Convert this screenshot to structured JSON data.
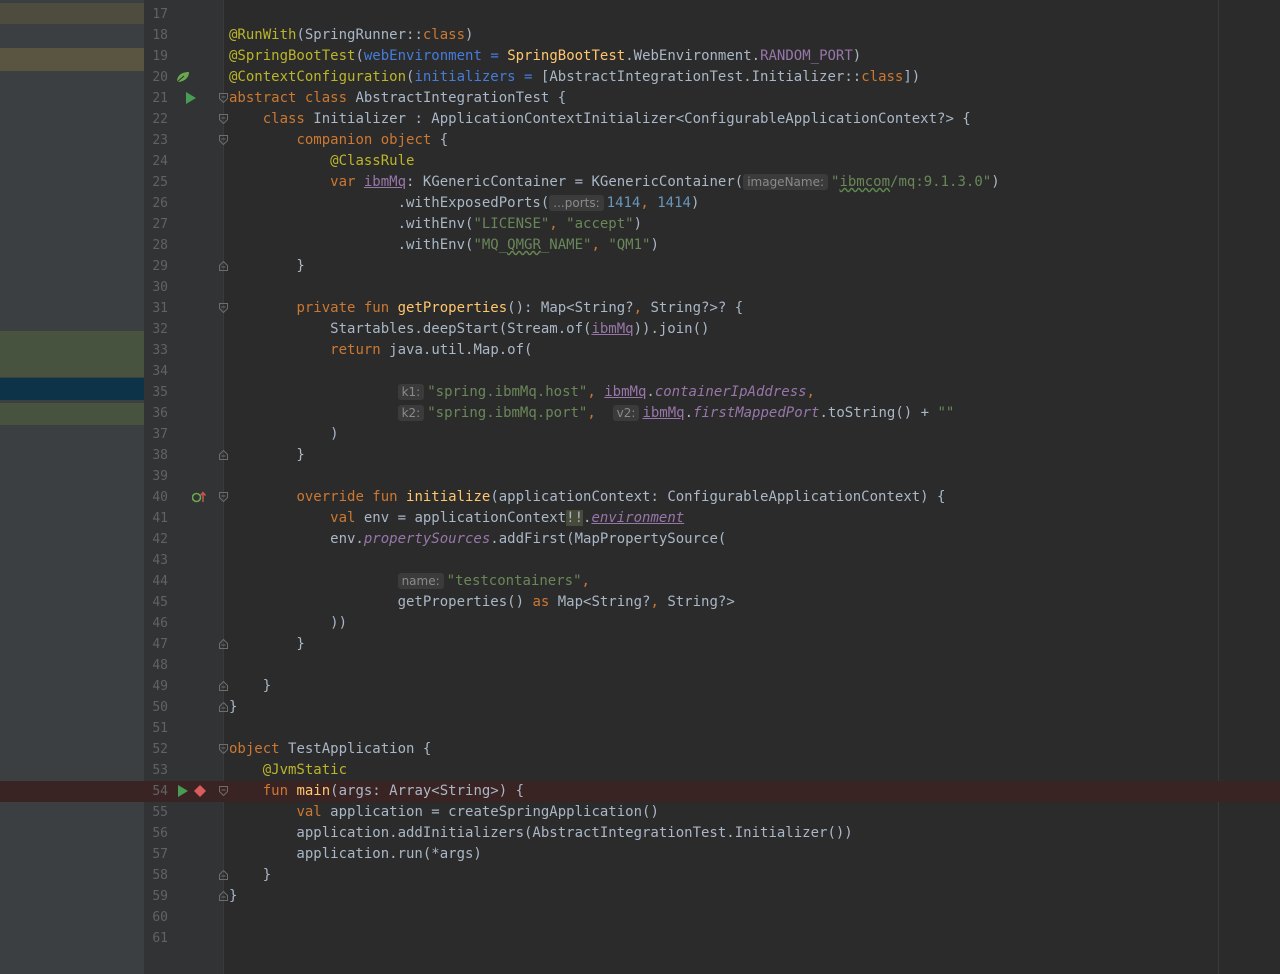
{
  "editor": {
    "first_line_number": 17,
    "lines": [
      {
        "n": "17",
        "tokens": []
      },
      {
        "n": "18",
        "tokens": [
          {
            "c": "an",
            "t": "@RunWith"
          },
          {
            "t": "(SpringRunner::"
          },
          {
            "c": "kw",
            "t": "class"
          },
          {
            "t": ")"
          }
        ]
      },
      {
        "n": "19",
        "tokens": [
          {
            "c": "an",
            "t": "@SpringBootTest"
          },
          {
            "t": "("
          },
          {
            "c": "prm",
            "t": "webEnvironment"
          },
          {
            "t": " "
          },
          {
            "c": "prm",
            "t": "="
          },
          {
            "t": " "
          },
          {
            "c": "fn",
            "t": "SpringBootTest"
          },
          {
            "t": ".WebEnvironment."
          },
          {
            "c": "cst",
            "t": "RANDOM_PORT"
          },
          {
            "t": ")"
          }
        ]
      },
      {
        "n": "20",
        "tokens": [
          {
            "c": "an",
            "t": "@ContextConfiguration"
          },
          {
            "t": "("
          },
          {
            "c": "prm",
            "t": "initializers"
          },
          {
            "t": " "
          },
          {
            "c": "prm",
            "t": "="
          },
          {
            "t": " [AbstractIntegrationTest.Initializer::"
          },
          {
            "c": "kw",
            "t": "class"
          },
          {
            "t": "])"
          }
        ]
      },
      {
        "n": "21",
        "tokens": [
          {
            "c": "kw",
            "t": "abstract class "
          },
          {
            "t": "AbstractIntegrationTest {"
          }
        ]
      },
      {
        "n": "22",
        "tokens": [
          {
            "t": "    "
          },
          {
            "c": "kw",
            "t": "class "
          },
          {
            "t": "Initializer : ApplicationContextInitializer<ConfigurableApplicationContext?> {"
          }
        ]
      },
      {
        "n": "23",
        "tokens": [
          {
            "t": "        "
          },
          {
            "c": "kw",
            "t": "companion object "
          },
          {
            "t": "{"
          }
        ]
      },
      {
        "n": "24",
        "tokens": [
          {
            "t": "            "
          },
          {
            "c": "an",
            "t": "@ClassRule"
          }
        ]
      },
      {
        "n": "25",
        "tokens": [
          {
            "t": "            "
          },
          {
            "c": "kw",
            "t": "var "
          },
          {
            "c": "pvar",
            "t": "ibmMq"
          },
          {
            "t": ": KGenericContainer = KGenericContainer("
          },
          {
            "c": "hint",
            "t": "imageName:"
          },
          {
            "c": "str",
            "t": "\""
          },
          {
            "c": "str wavy",
            "t": "ibmcom"
          },
          {
            "c": "str",
            "t": "/mq:9.1.3.0\""
          },
          {
            "t": ")"
          }
        ]
      },
      {
        "n": "26",
        "tokens": [
          {
            "t": "                    .withExposedPorts("
          },
          {
            "c": "hint",
            "t": "...ports:"
          },
          {
            "c": "num",
            "t": "1414"
          },
          {
            "c": "kw",
            "t": ", "
          },
          {
            "c": "num",
            "t": "1414"
          },
          {
            "t": ")"
          }
        ]
      },
      {
        "n": "27",
        "tokens": [
          {
            "t": "                    .withEnv("
          },
          {
            "c": "str",
            "t": "\"LICENSE\""
          },
          {
            "c": "kw",
            "t": ", "
          },
          {
            "c": "str",
            "t": "\"accept\""
          },
          {
            "t": ")"
          }
        ]
      },
      {
        "n": "28",
        "tokens": [
          {
            "t": "                    .withEnv("
          },
          {
            "c": "str",
            "t": "\"MQ_"
          },
          {
            "c": "str wavy2",
            "t": "QMGR"
          },
          {
            "c": "str",
            "t": "_NAME\""
          },
          {
            "c": "kw",
            "t": ", "
          },
          {
            "c": "str",
            "t": "\"QM1\""
          },
          {
            "t": ")"
          }
        ]
      },
      {
        "n": "29",
        "tokens": [
          {
            "t": "        }"
          }
        ]
      },
      {
        "n": "30",
        "tokens": []
      },
      {
        "n": "31",
        "tokens": [
          {
            "t": "        "
          },
          {
            "c": "kw",
            "t": "private fun "
          },
          {
            "c": "fn",
            "t": "getProperties"
          },
          {
            "t": "(): Map<String?"
          },
          {
            "c": "kw",
            "t": ", "
          },
          {
            "t": "String?>? {"
          }
        ]
      },
      {
        "n": "32",
        "tokens": [
          {
            "t": "            Startables.deepStart(Stream.of("
          },
          {
            "c": "pvar",
            "t": "ibmMq"
          },
          {
            "t": ")).join()"
          }
        ]
      },
      {
        "n": "33",
        "tokens": [
          {
            "t": "            "
          },
          {
            "c": "kw",
            "t": "return "
          },
          {
            "t": "java.util.Map.of("
          }
        ]
      },
      {
        "n": "34",
        "tokens": []
      },
      {
        "n": "35",
        "tokens": [
          {
            "t": "                    "
          },
          {
            "c": "hint",
            "t": "k1:"
          },
          {
            "c": "str",
            "t": "\"spring.ibmMq.host\""
          },
          {
            "c": "kw",
            "t": ", "
          },
          {
            "c": "pvar",
            "t": "ibmMq"
          },
          {
            "t": "."
          },
          {
            "c": "prop",
            "t": "containerIpAddress"
          },
          {
            "c": "kw",
            "t": ","
          }
        ]
      },
      {
        "n": "36",
        "tokens": [
          {
            "t": "                    "
          },
          {
            "c": "hint",
            "t": "k2:"
          },
          {
            "c": "str",
            "t": "\"spring.ibmMq.port\""
          },
          {
            "c": "kw",
            "t": ",  "
          },
          {
            "c": "hint",
            "t": "v2:"
          },
          {
            "c": "pvar",
            "t": "ibmMq"
          },
          {
            "t": "."
          },
          {
            "c": "prop",
            "t": "firstMappedPort"
          },
          {
            "t": ".toString() + "
          },
          {
            "c": "str",
            "t": "\"\""
          }
        ]
      },
      {
        "n": "37",
        "tokens": [
          {
            "t": "            )"
          }
        ]
      },
      {
        "n": "38",
        "tokens": [
          {
            "t": "        }"
          }
        ]
      },
      {
        "n": "39",
        "tokens": []
      },
      {
        "n": "40",
        "tokens": [
          {
            "t": "        "
          },
          {
            "c": "kw",
            "t": "override fun "
          },
          {
            "c": "fn",
            "t": "initialize"
          },
          {
            "t": "(applicationContext: ConfigurableApplicationContext) {"
          }
        ]
      },
      {
        "n": "41",
        "tokens": [
          {
            "t": "            "
          },
          {
            "c": "kw",
            "t": "val "
          },
          {
            "t": "env = applicationContext"
          },
          {
            "c": "bang",
            "t": "!!"
          },
          {
            "t": "."
          },
          {
            "c": "prop ul",
            "t": "environment"
          }
        ]
      },
      {
        "n": "42",
        "tokens": [
          {
            "t": "            env."
          },
          {
            "c": "prop",
            "t": "propertySources"
          },
          {
            "t": ".addFirst(MapPropertySource("
          }
        ]
      },
      {
        "n": "43",
        "tokens": []
      },
      {
        "n": "44",
        "tokens": [
          {
            "t": "                    "
          },
          {
            "c": "hint",
            "t": "name:"
          },
          {
            "c": "str",
            "t": "\"testcontainers\""
          },
          {
            "c": "kw",
            "t": ","
          }
        ]
      },
      {
        "n": "45",
        "tokens": [
          {
            "t": "                    getProperties() "
          },
          {
            "c": "kw",
            "t": "as "
          },
          {
            "t": "Map<String?"
          },
          {
            "c": "kw",
            "t": ", "
          },
          {
            "t": "String?>"
          }
        ]
      },
      {
        "n": "46",
        "tokens": [
          {
            "t": "            ))"
          }
        ]
      },
      {
        "n": "47",
        "tokens": [
          {
            "t": "        }"
          }
        ]
      },
      {
        "n": "48",
        "tokens": []
      },
      {
        "n": "49",
        "tokens": [
          {
            "t": "    }"
          }
        ]
      },
      {
        "n": "50",
        "tokens": [
          {
            "t": "}"
          }
        ]
      },
      {
        "n": "51",
        "tokens": []
      },
      {
        "n": "52",
        "tokens": [
          {
            "c": "kw",
            "t": "object "
          },
          {
            "t": "TestApplication {"
          }
        ]
      },
      {
        "n": "53",
        "tokens": [
          {
            "t": "    "
          },
          {
            "c": "an",
            "t": "@JvmStatic"
          }
        ]
      },
      {
        "n": "54",
        "tokens": [
          {
            "t": "    "
          },
          {
            "c": "kw",
            "t": "fun "
          },
          {
            "c": "fn",
            "t": "main"
          },
          {
            "t": "(args: Array<String>) {"
          }
        ]
      },
      {
        "n": "55",
        "tokens": [
          {
            "t": "        "
          },
          {
            "c": "kw",
            "t": "val "
          },
          {
            "t": "application = createSpringApplication()"
          }
        ]
      },
      {
        "n": "56",
        "tokens": [
          {
            "t": "        application.addInitializers(AbstractIntegrationTest.Initializer())"
          }
        ]
      },
      {
        "n": "57",
        "tokens": [
          {
            "t": "        application.run(*args)"
          }
        ]
      },
      {
        "n": "58",
        "tokens": [
          {
            "t": "    }"
          }
        ]
      },
      {
        "n": "59",
        "tokens": [
          {
            "t": "}"
          }
        ]
      },
      {
        "n": "60",
        "tokens": []
      },
      {
        "n": "61",
        "tokens": []
      }
    ],
    "fold_lines": [
      "21",
      "22",
      "23",
      "29",
      "31",
      "38",
      "40",
      "47",
      "49",
      "50",
      "52",
      "54",
      "58",
      "59"
    ],
    "gutter_icons": {
      "20": "spring-bean-icon",
      "21": "run-icon",
      "40": "override-icon",
      "54": "run-icon"
    },
    "breakpoint_lines": [
      "54"
    ]
  },
  "colors": {
    "background": "#2b2b2b",
    "gutter": "#313335",
    "keyword": "#cc7832",
    "annotation": "#bbb529",
    "string": "#6a8759",
    "number": "#6897bb",
    "function": "#ffc66d",
    "breakpoint": "#db5c5c",
    "run": "#499c54"
  }
}
